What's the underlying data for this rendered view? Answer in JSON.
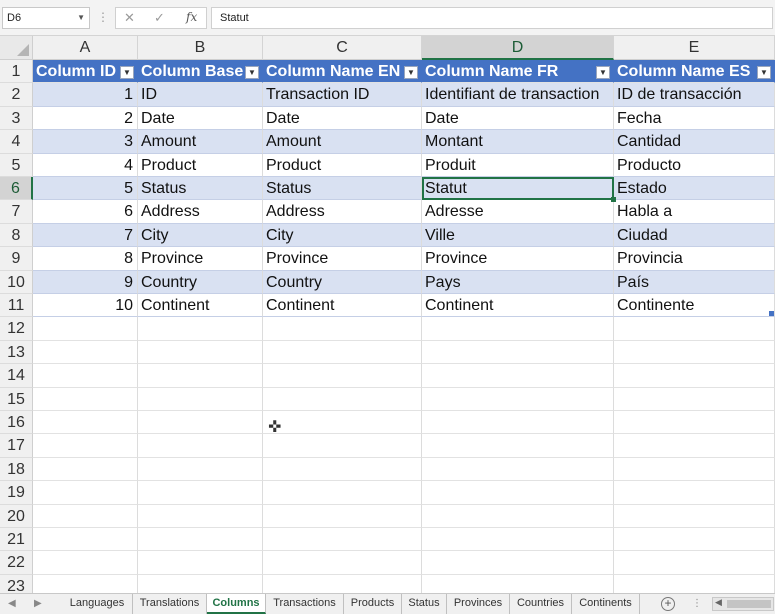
{
  "formula_bar": {
    "name_box": "D6",
    "fx_label": "fx",
    "content": "Statut"
  },
  "columns": [
    "A",
    "B",
    "C",
    "D",
    "E"
  ],
  "rows": [
    "1",
    "2",
    "3",
    "4",
    "5",
    "6",
    "7",
    "8",
    "9",
    "10",
    "11",
    "12",
    "13",
    "14",
    "15",
    "16",
    "17",
    "18",
    "19",
    "20",
    "21",
    "22",
    "23"
  ],
  "table": {
    "headers": [
      "Column ID",
      "Column Base",
      "Column Name EN",
      "Column Name FR",
      "Column Name ES"
    ],
    "rows": [
      [
        "1",
        "ID",
        "Transaction ID",
        "Identifiant de transaction",
        "ID de transacción"
      ],
      [
        "2",
        "Date",
        "Date",
        "Date",
        "Fecha"
      ],
      [
        "3",
        "Amount",
        "Amount",
        "Montant",
        "Cantidad"
      ],
      [
        "4",
        "Product",
        "Product",
        "Produit",
        "Producto"
      ],
      [
        "5",
        "Status",
        "Status",
        "Statut",
        "Estado"
      ],
      [
        "6",
        "Address",
        "Address",
        "Adresse",
        "Habla a"
      ],
      [
        "7",
        "City",
        "City",
        "Ville",
        "Ciudad"
      ],
      [
        "8",
        "Province",
        "Province",
        "Province",
        "Provincia"
      ],
      [
        "9",
        "Country",
        "Country",
        "Pays",
        "País"
      ],
      [
        "10",
        "Continent",
        "Continent",
        "Continent",
        "Continente"
      ]
    ]
  },
  "sheet_tabs": [
    "Languages",
    "Translations",
    "Columns",
    "Transactions",
    "Products",
    "Status",
    "Provinces",
    "Countries",
    "Continents"
  ],
  "active_sheet": "Columns",
  "colors": {
    "header_fill": "#4472c4",
    "band_fill": "#d9e1f2",
    "selection": "#217346"
  }
}
